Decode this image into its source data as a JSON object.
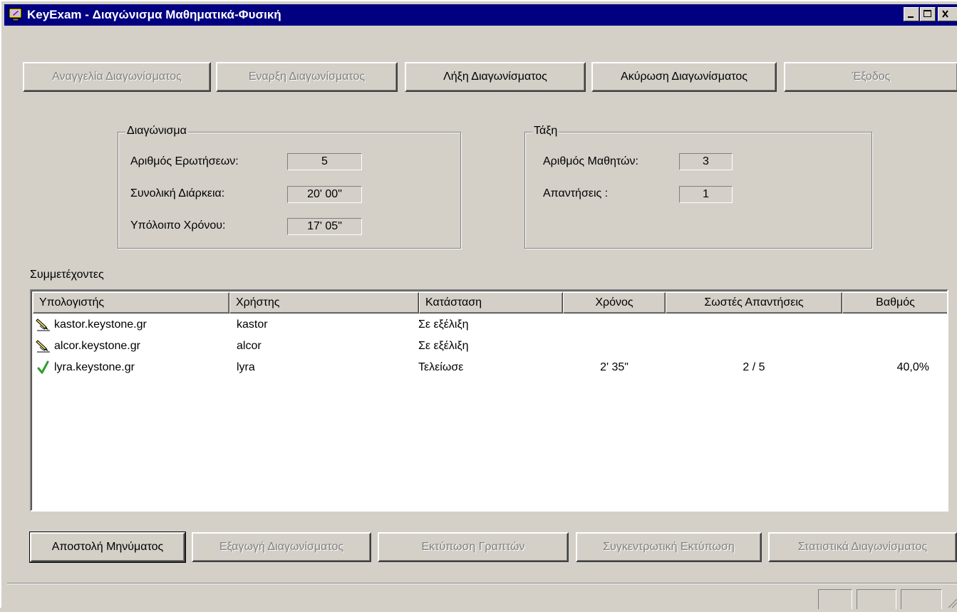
{
  "window": {
    "title": "KeyExam - Διαγώνισμα Μαθηματικά-Φυσική",
    "icon": "app-monitor-icon"
  },
  "toolbar": {
    "announce": "Αναγγελία Διαγωνίσματος",
    "start": "Εναρξη Διαγωνίσματος",
    "end": "Λήξη Διαγωνίσματος",
    "cancel": "Ακύρωση Διαγωνίσματος",
    "exit": "Έξοδος"
  },
  "exam_group": {
    "label": "Διαγώνισμα",
    "questions_label": "Αριθμός Ερωτήσεων:",
    "questions_value": "5",
    "duration_label": "Συνολική Διάρκεια:",
    "duration_value": "20' 00\"",
    "remaining_label": "Υπόλοιπο Χρόνου:",
    "remaining_value": "17' 05\""
  },
  "class_group": {
    "label": "Τάξη",
    "students_label": "Αριθμός Μαθητών:",
    "students_value": "3",
    "answers_label": "Απαντήσεις :",
    "answers_value": "1"
  },
  "participants": {
    "label": "Συμμετέχοντες",
    "columns": [
      "Υπολογιστής",
      "Χρήστης",
      "Κατάσταση",
      "Χρόνος",
      "Σωστές Απαντήσεις",
      "Βαθμός"
    ],
    "rows": [
      {
        "icon": "pencil-writing-icon",
        "computer": "kastor.keystone.gr",
        "user": "kastor",
        "status": "Σε εξέλιξη",
        "time": "",
        "correct": "",
        "grade": ""
      },
      {
        "icon": "pencil-writing-icon",
        "computer": "alcor.keystone.gr",
        "user": "alcor",
        "status": "Σε εξέλιξη",
        "time": "",
        "correct": "",
        "grade": ""
      },
      {
        "icon": "checkmark-icon",
        "computer": "lyra.keystone.gr",
        "user": "lyra",
        "status": "Τελείωσε",
        "time": "2' 35\"",
        "correct": "2 / 5",
        "grade": "40,0%"
      }
    ]
  },
  "bottom_buttons": {
    "send_message": "Αποστολή Μηνύματος",
    "export": "Εξαγωγή Διαγωνίσματος",
    "print_papers": "Εκτύπωση Γραπτών",
    "summary_print": "Συγκεντρωτική Εκτύπωση",
    "statistics": "Στατιστικά Διαγωνίσματος"
  },
  "colors": {
    "titlebar": "#000080",
    "face": "#d4d0c8",
    "check": "#2f9e2f"
  }
}
